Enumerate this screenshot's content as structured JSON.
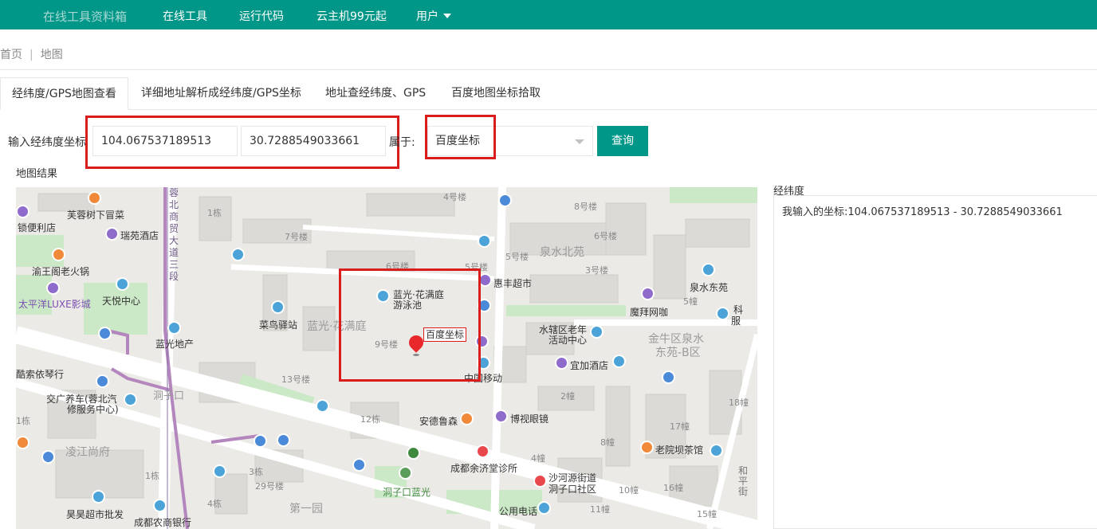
{
  "topnav": {
    "brand": "在线工具资料箱",
    "items": [
      "在线工具",
      "运行代码",
      "云主机99元起",
      "用户"
    ]
  },
  "breadcrumb": {
    "home": "首页",
    "sep": "|",
    "current": "地图"
  },
  "tabs": [
    "经纬度/GPS地图查看",
    "详细地址解析成经纬度/GPS坐标",
    "地址查经纬度、GPS",
    "百度地图坐标拾取"
  ],
  "form": {
    "label": "输入经纬度坐标",
    "lng_value": "104.067537189513",
    "lat_value": "30.7288549033661",
    "belong_label": "属于:",
    "coord_type": "百度坐标",
    "query_button": "查询"
  },
  "map": {
    "title": "地图结果",
    "marker_label": "百度坐标",
    "pois": [
      "芙蓉树下冒菜",
      "锁便利店",
      "瑞苑酒店",
      "渝王阁老火锅",
      "太平洋LUXE影城",
      "天悦中心",
      "蓝光地产",
      "菜鸟驿站",
      "蓝光·花满庭",
      "游泳池",
      "惠丰超市",
      "水辖区老年",
      "活动中心",
      "泉水东苑",
      "魔拜网咖",
      "宜加酒店",
      "酷索依琴行",
      "交广养车(蓉北汽",
      "修服务中心)",
      "洞子口",
      "安德鲁森",
      "博视眼镜",
      "成都余济堂诊所",
      "沙河源街道",
      "洞子口社区",
      "老院坝茶馆",
      "凌江尚府",
      "第一园",
      "昊昊超市批发",
      "成都农商银行",
      "洞子口蓝光",
      "公用电话",
      "中国移动",
      "蓉北商贸大道三段",
      "科",
      "服",
      "和平街"
    ],
    "areas": [
      "泉水北苑",
      "蓝光·花满庭",
      "金牛区泉水",
      "东苑-B区"
    ],
    "buildings": [
      "4号楼",
      "8号楼",
      "6号楼",
      "1栋",
      "7号楼",
      "6号楼",
      "5号楼",
      "5号楼",
      "3号楼",
      "5幢",
      "9号楼",
      "13号楼",
      "12栋",
      "2幢",
      "18幢",
      "17幢",
      "8幢",
      "4幢",
      "1栋",
      "3栋",
      "29号楼",
      "4栋",
      "10幢",
      "16幢",
      "15幢",
      "11幢",
      "1栋"
    ]
  },
  "result": {
    "title": "经纬度",
    "text": "我输入的坐标:104.067537189513 - 30.7288549033661"
  }
}
